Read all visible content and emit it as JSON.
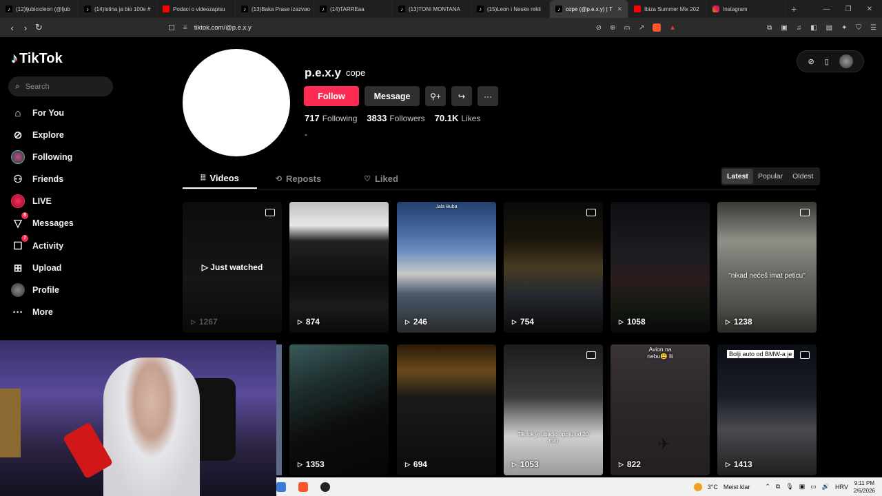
{
  "browser": {
    "tabs": [
      {
        "label": "(12)ljubicicleon (@ljub",
        "favicon": "tiktok"
      },
      {
        "label": "(14)Istina ja bio 100e #",
        "favicon": "tiktok"
      },
      {
        "label": "Podaci o videozapisu",
        "favicon": "youtube"
      },
      {
        "label": "(13)Baka Prase izazvao",
        "favicon": "tiktok"
      },
      {
        "label": "(14)TARREaa",
        "favicon": "tiktok"
      },
      {
        "label": "(13)TONI MONTANA",
        "favicon": "tiktok"
      },
      {
        "label": "(15)Leon i Neske rekli",
        "favicon": "tiktok"
      },
      {
        "label": "cope (@p.e.x.y) | T",
        "favicon": "tiktok",
        "active": true
      },
      {
        "label": "Ibiza Summer Mix 202",
        "favicon": "youtube"
      },
      {
        "label": "Instagram",
        "favicon": "instagram"
      }
    ],
    "url": "tiktok.com/@p.e.x.y"
  },
  "sidebar": {
    "logo": "TikTok",
    "search_placeholder": "Search",
    "items": [
      {
        "label": "For You",
        "icon": "home-icon"
      },
      {
        "label": "Explore",
        "icon": "compass-icon"
      },
      {
        "label": "Following",
        "icon": "following-avatar-icon"
      },
      {
        "label": "Friends",
        "icon": "friends-icon"
      },
      {
        "label": "LIVE",
        "icon": "live-icon"
      },
      {
        "label": "Messages",
        "icon": "messages-icon",
        "badge": "8"
      },
      {
        "label": "Activity",
        "icon": "activity-icon",
        "badge": "7"
      },
      {
        "label": "Upload",
        "icon": "upload-icon"
      },
      {
        "label": "Profile",
        "icon": "profile-avatar-icon"
      },
      {
        "label": "More",
        "icon": "more-icon"
      }
    ]
  },
  "profile": {
    "username": "p.e.x.y",
    "nickname": "cope",
    "follow_label": "Follow",
    "message_label": "Message",
    "following_count": "717",
    "following_label": "Following",
    "followers_count": "3833",
    "followers_label": "Followers",
    "likes_count": "70.1K",
    "likes_label": "Likes",
    "bio": "-"
  },
  "content_tabs": {
    "videos": "Videos",
    "reposts": "Reposts",
    "liked": "Liked"
  },
  "sort": {
    "latest": "Latest",
    "popular": "Popular",
    "oldest": "Oldest"
  },
  "videos": [
    {
      "views": "1267",
      "overlay": "Just watched"
    },
    {
      "views": "874"
    },
    {
      "views": "246",
      "caption": "Jala Buba"
    },
    {
      "views": "754"
    },
    {
      "views": "1058"
    },
    {
      "views": "1238",
      "caption": "\"nikad nećeš imat peticu\""
    },
    {
      "views": "1353"
    },
    {
      "views": "694"
    },
    {
      "views": "1053",
      "caption": "Tik tok je ubacio opciju od 20 min"
    },
    {
      "views": "822",
      "caption": "Avion na nebu😩 lli"
    },
    {
      "views": "1413",
      "caption": "Bolji auto od BMW-a je"
    }
  ],
  "taskbar": {
    "temperature": "3°C",
    "weather": "Meist klar",
    "lang": "HRV",
    "time": "9:11 PM",
    "date": "2/6/2026"
  }
}
